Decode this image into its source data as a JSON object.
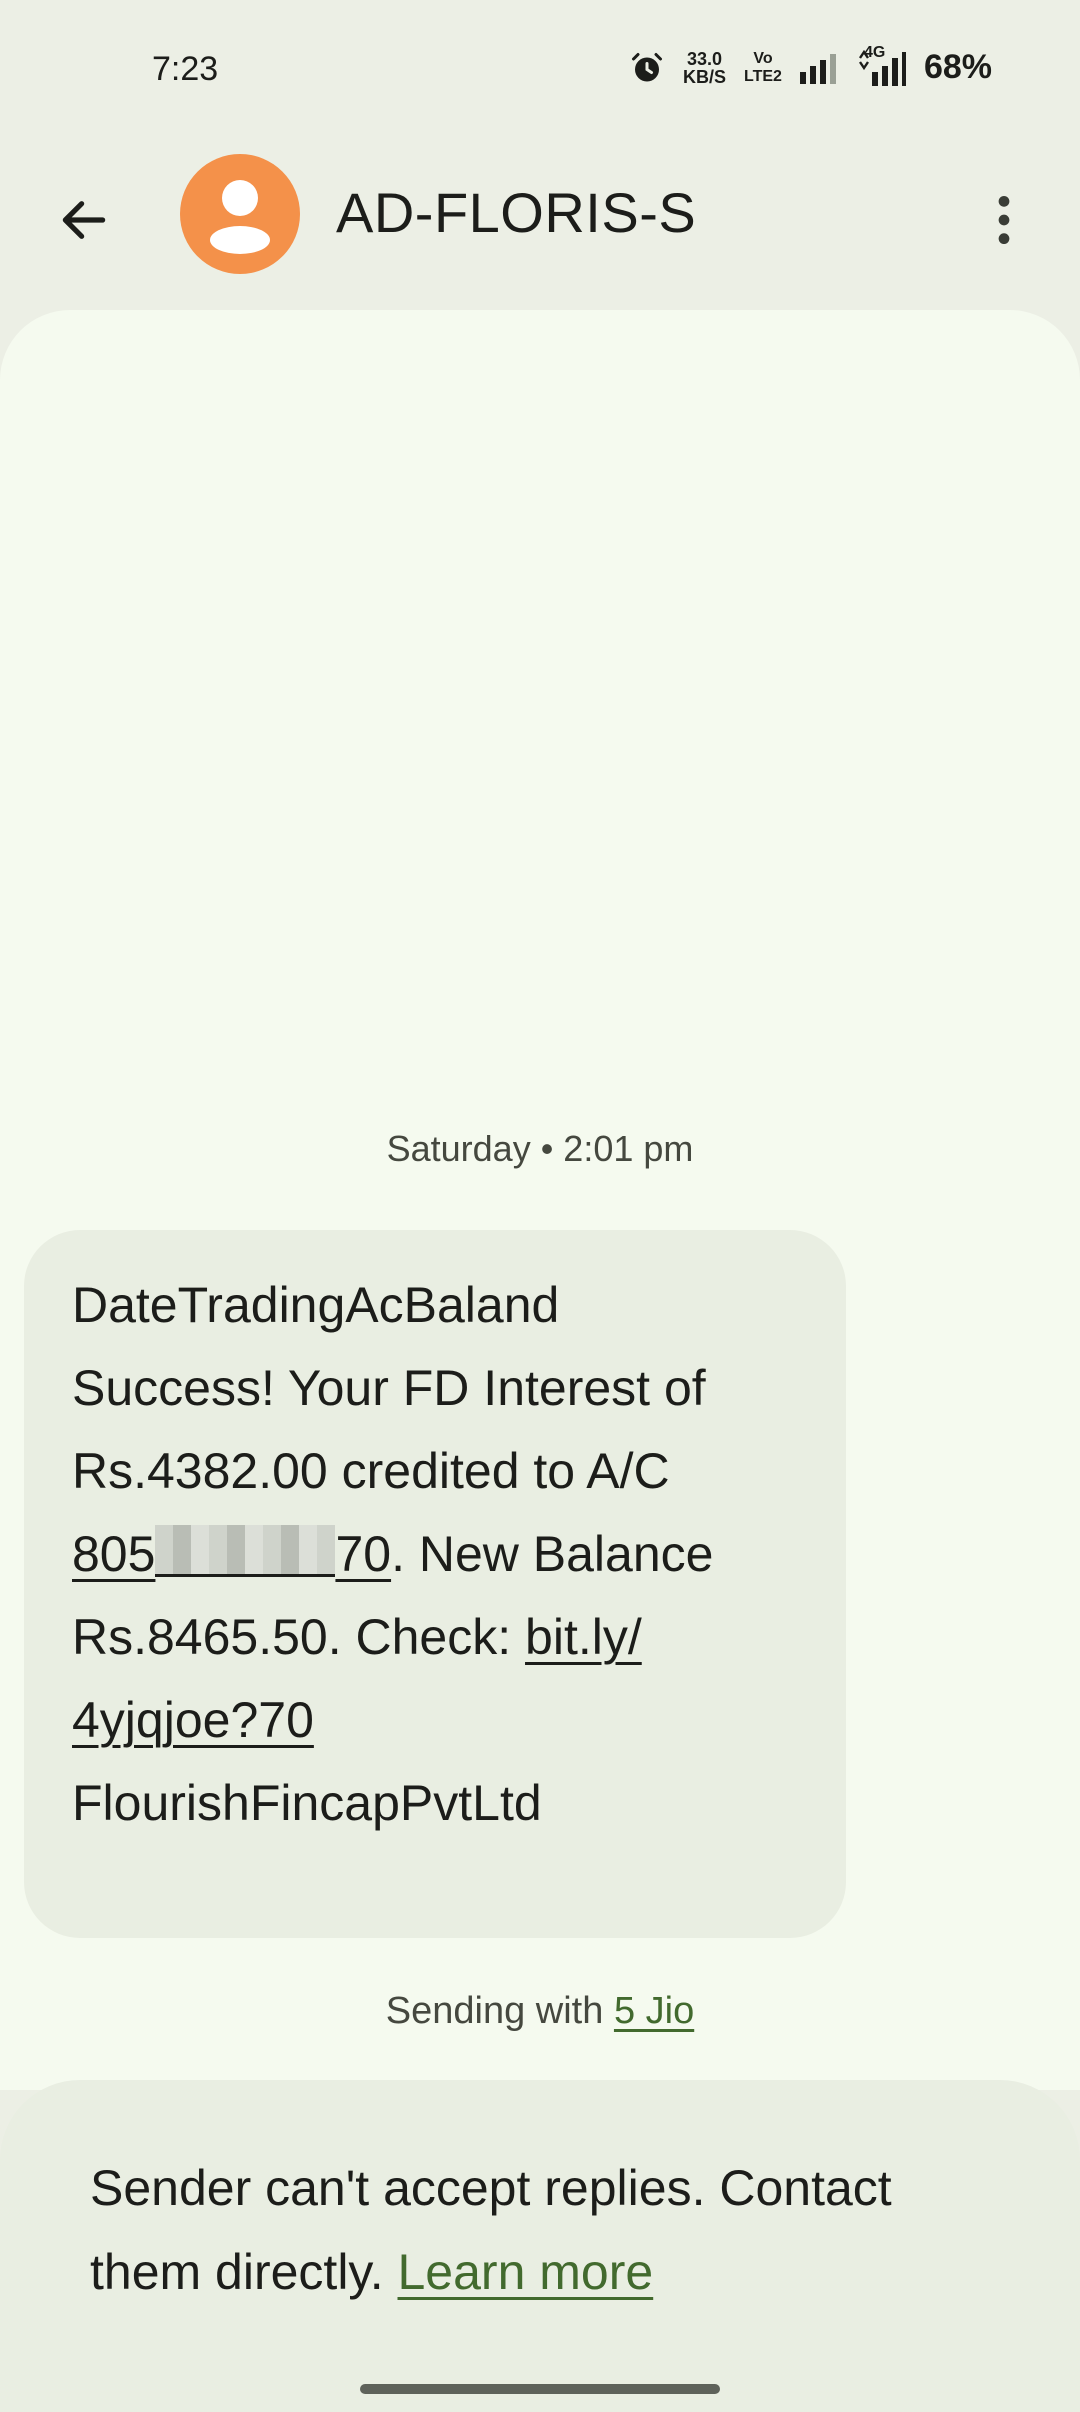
{
  "status_bar": {
    "time": "7:23",
    "net_speed_value": "33.0",
    "net_speed_unit": "KB/S",
    "volte_top": "Vo",
    "volte_bottom": "LTE2",
    "network_type": "4G",
    "battery": "68%",
    "icons": [
      "alarm-icon",
      "signal-icon",
      "signal-4g-icon"
    ]
  },
  "app_bar": {
    "title": "AD-FLORIS-S",
    "avatar_color": "#F4914A",
    "back_icon": "arrow-left-icon",
    "more_icon": "more-vert-icon"
  },
  "conversation": {
    "date_separator": "Saturday • 2:01 pm",
    "message": {
      "line1": "DateTradingAcBaland",
      "line2": "Success! Your FD Interest of",
      "line3": "Rs.4382.00 credited to A/C",
      "acct_prefix": "805",
      "acct_suffix": "70",
      "line4_rest": ". New Balance",
      "line5_text": "Rs.8465.50. Check: ",
      "link_part1": "bit.ly/",
      "link_part2": "4yjqjoe?70",
      "line7": "FlourishFincapPvtLtd"
    },
    "sending_prefix": "Sending with ",
    "sending_sim": "5 Jio"
  },
  "info_sheet": {
    "text": "Sender can't accept replies. Contact them directly. ",
    "learn_more": "Learn more"
  },
  "colors": {
    "background": "#ECEFE5",
    "surface": "#F5FAEF",
    "bubble": "#E9EEE2",
    "link": "#426A2E"
  }
}
